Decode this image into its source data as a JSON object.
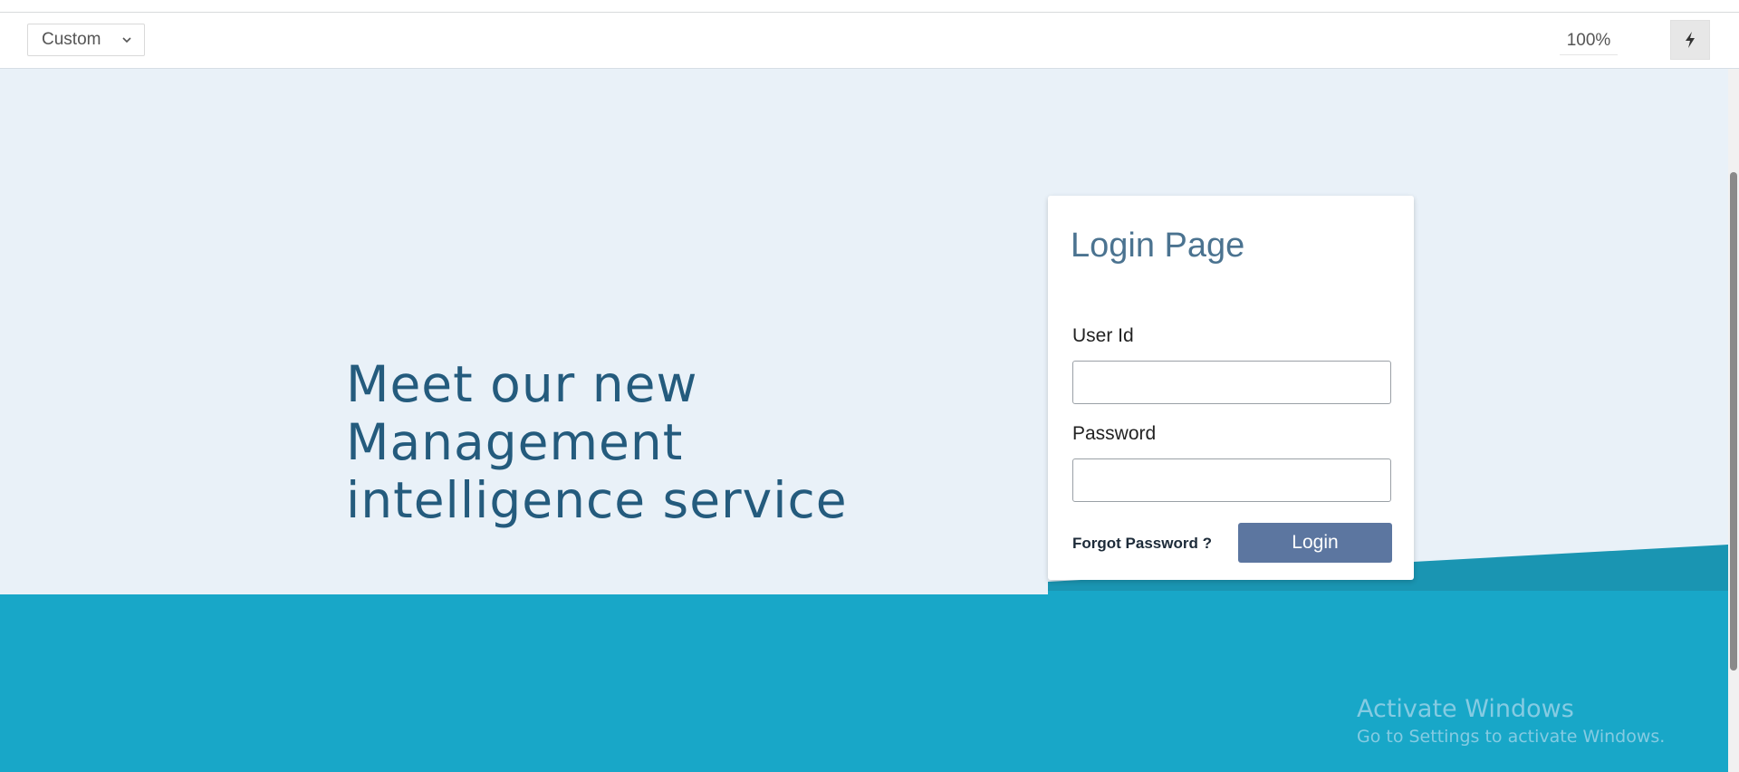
{
  "toolbar": {
    "device_select": "Custom",
    "zoom": "100%"
  },
  "hero": {
    "headline_line1": "Meet our new Management",
    "headline_line2": "intelligence service"
  },
  "login": {
    "title": "Login Page",
    "user_id_label": "User Id",
    "user_id_value": "",
    "password_label": "Password",
    "password_value": "",
    "forgot_password": "Forgot Password ?",
    "login_button": "Login"
  },
  "watermark": {
    "title": "Activate Windows",
    "subtitle": "Go to Settings to activate Windows."
  },
  "colors": {
    "page_bg": "#e9f1f8",
    "band_teal": "#18a7c8",
    "band_teal_dark": "#1a95b2",
    "headline": "#245b7d",
    "login_title": "#4b7390",
    "login_button": "#5c76a0"
  },
  "icons": {
    "device_dropdown": "chevron-down-icon",
    "throttle": "lightning-bolt-icon"
  }
}
